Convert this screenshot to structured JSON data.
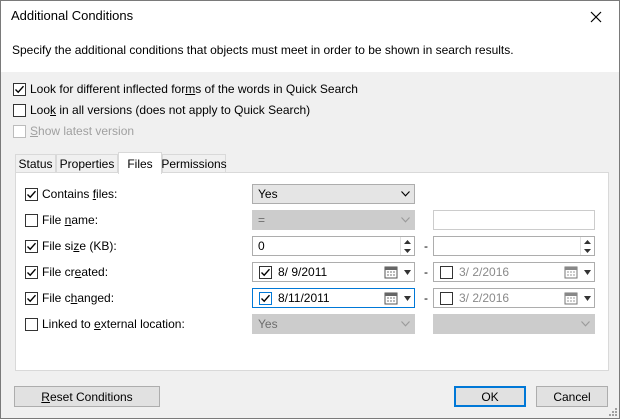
{
  "window": {
    "title": "Additional Conditions",
    "description": "Specify the additional conditions that objects must meet in order to be shown in search results."
  },
  "options": {
    "inflected": {
      "pre": "Look for different inflected for",
      "key": "m",
      "post": "s of the words in Quick Search",
      "checked": true
    },
    "all_versions": {
      "pre": "Loo",
      "key": "k",
      "post": " in all versions (does not apply to Quick Search)",
      "checked": false
    },
    "latest": {
      "pre": "",
      "key": "S",
      "post": "how latest version",
      "checked": false,
      "disabled": true
    }
  },
  "tabs": [
    {
      "label": "Status"
    },
    {
      "label": "Properties"
    },
    {
      "label": "Files",
      "active": true
    },
    {
      "label": "Permissions"
    }
  ],
  "conditions": {
    "contains_files": {
      "pre": "Contains ",
      "key": "f",
      "post": "iles:",
      "checked": true,
      "value": "Yes"
    },
    "file_name": {
      "pre": "File ",
      "key": "n",
      "post": "ame:",
      "checked": false,
      "operator": "=",
      "value": ""
    },
    "file_size": {
      "pre": "File si",
      "key": "z",
      "post": "e (KB):",
      "checked": true,
      "from": "0",
      "to": ""
    },
    "file_created": {
      "pre": "File cr",
      "key": "e",
      "post": "ated:",
      "checked": true,
      "from": "8/ 9/2011",
      "to": "3/ 2/2016"
    },
    "file_changed": {
      "pre": "File c",
      "key": "h",
      "post": "anged:",
      "checked": true,
      "from": "8/11/2011",
      "to": "3/ 2/2016"
    },
    "linked": {
      "pre": "Linked to ",
      "key": "e",
      "post": "xternal location:",
      "checked": false,
      "value": "Yes",
      "value2": ""
    },
    "range_separator": "-"
  },
  "buttons": {
    "reset": {
      "pre": "",
      "key": "R",
      "post": "eset Conditions"
    },
    "ok": "OK",
    "cancel": "Cancel"
  }
}
